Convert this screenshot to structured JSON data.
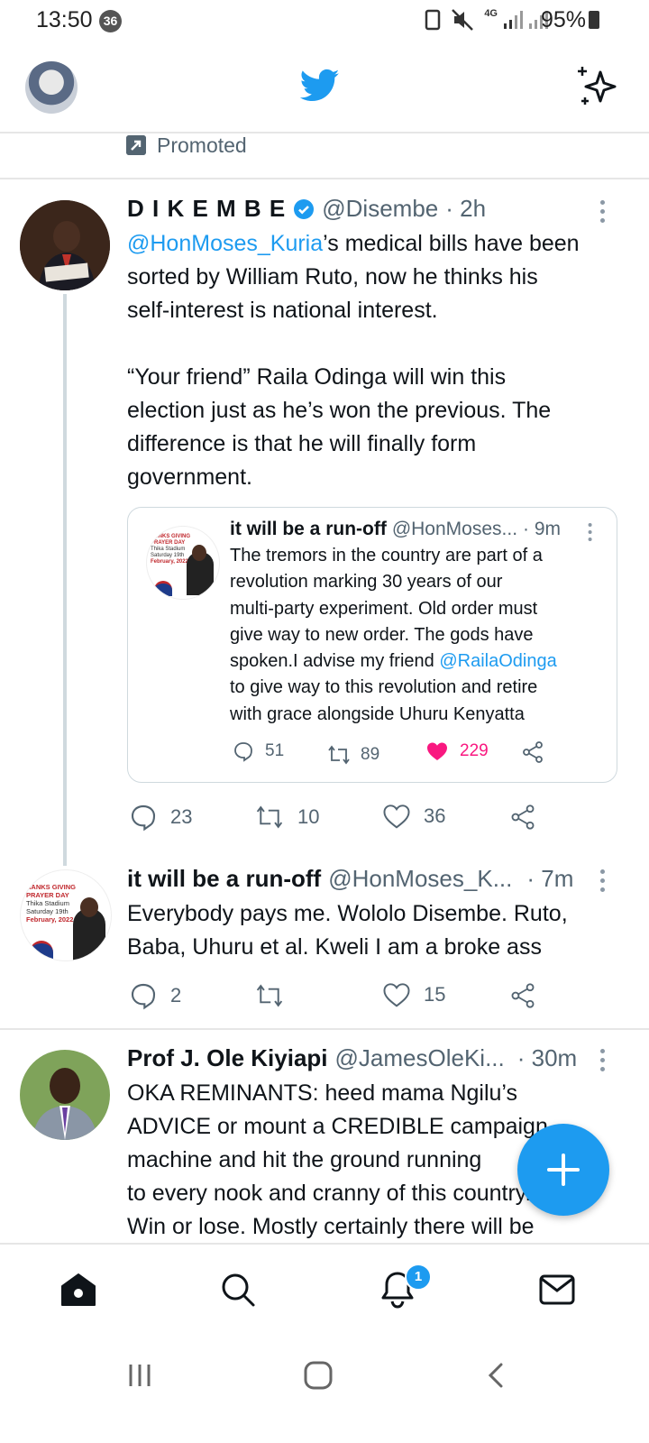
{
  "status_bar": {
    "time": "13:50",
    "notification_count": "36",
    "network": "4G",
    "battery": "95%"
  },
  "promoted": {
    "label": "Promoted"
  },
  "tweets": [
    {
      "name": "D I K E M B E",
      "verified": true,
      "handle": "@Disembe",
      "time": "· 2h",
      "mention": "@HonMoses_Kuria",
      "text_line1_rest": "’s medical bills have been",
      "text_line2": "sorted by William Ruto, now he thinks his",
      "text_line3": "self-interest is national interest.",
      "text_line4": "“Your friend” Raila Odinga will win this",
      "text_line5": "election just as he’s won the previous. The",
      "text_line6": "difference is that he will finally form",
      "text_line7": "government.",
      "quote": {
        "name": "it will be a run-off",
        "handle": "@HonMoses...",
        "time": "· 9m",
        "lines": [
          "The tremors in  the country are part of  a",
          "revolution marking 30 years of our",
          "multi-party experiment. Old order must",
          "give way to new order. The gods have",
          "spoken.I advise my friend "
        ],
        "mention": "@RailaOdinga",
        "lines_after": [
          "to give way to this revolution and retire",
          "with grace alongside Uhuru Kenyatta"
        ],
        "replies": "51",
        "retweets": "89",
        "likes": "229",
        "avatar_text": [
          "HANKS GIVING",
          "PRAYER DAY",
          "Thika Stadium",
          "Saturday 19th",
          "February, 2022"
        ]
      },
      "replies": "23",
      "retweets": "10",
      "likes": "36"
    },
    {
      "name": "it will be a run-off",
      "handle": "@HonMoses_K...",
      "time": "· 7m",
      "text_line1": "Everybody pays me. Wololo Disembe. Ruto,",
      "text_line2": "Baba, Uhuru et al.  Kweli I am a broke ass",
      "replies": "2",
      "retweets": "",
      "likes": "15",
      "avatar_text": [
        "HANKS GIVING",
        "PRAYER DAY",
        "Thika Stadium",
        "Saturday 19th",
        "February, 2022"
      ]
    },
    {
      "name": "Prof J. Ole Kiyiapi",
      "handle": "@JamesOleKi...",
      "time": "· 30m",
      "text_line1": "OKA REMINANTS: heed mama Ngilu’s",
      "text_line2": "ADVICE or mount a CREDIBLE campaign",
      "text_line3": "machine and hit the ground running",
      "text_line4": "to every nook and cranny of this country.",
      "text_line5": "Win or lose. Mostly certainly there will be"
    }
  ],
  "bottom_nav": {
    "notifications_badge": "1"
  },
  "colors": {
    "brand": "#1d9bf0",
    "like": "#f91880",
    "muted": "#536471"
  }
}
